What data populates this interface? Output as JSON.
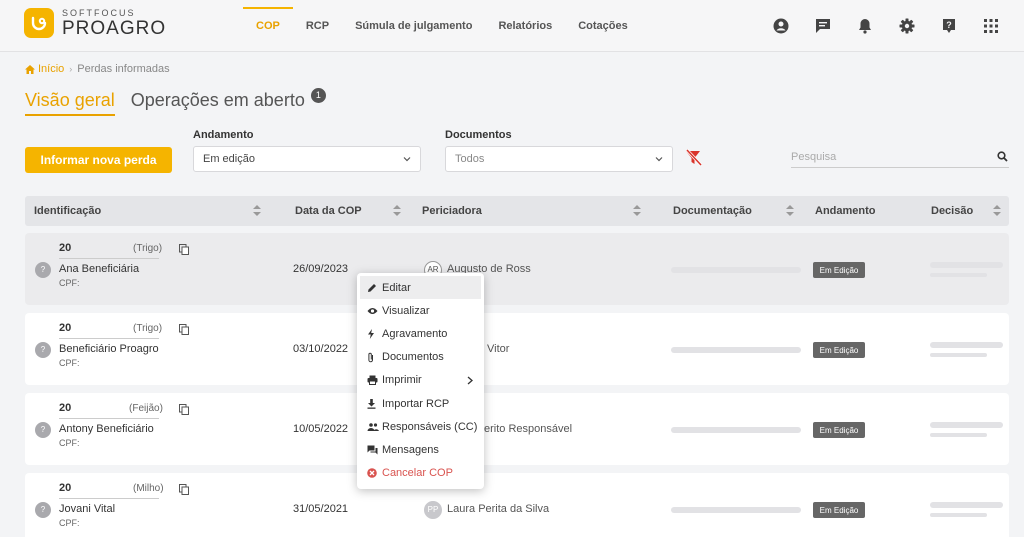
{
  "app": {
    "brand_small": "SOFTFOCUS",
    "brand_big": "PROAGRO",
    "accent": "#f5b400"
  },
  "nav": {
    "items": [
      {
        "label": "COP",
        "active": true
      },
      {
        "label": "RCP"
      },
      {
        "label": "Súmula de julgamento"
      },
      {
        "label": "Relatórios"
      },
      {
        "label": "Cotações"
      }
    ],
    "icons": [
      "account-circle-icon",
      "chat-icon",
      "bell-icon",
      "gear-icon",
      "help-icon",
      "apps-grid-icon"
    ]
  },
  "breadcrumb": {
    "home": "Início",
    "current": "Perdas informadas"
  },
  "tabs": {
    "overview": "Visão geral",
    "open_ops": "Operações em aberto",
    "open_ops_badge": "1"
  },
  "filters": {
    "new_loss_button": "Informar nova perda",
    "andamento_label": "Andamento",
    "andamento_value": "Em edição",
    "documentos_label": "Documentos",
    "documentos_value": "Todos",
    "search_placeholder": "Pesquisa"
  },
  "table": {
    "headers": {
      "identificacao": "Identificação",
      "data_cop": "Data da COP",
      "periciadora": "Periciadora",
      "documentacao": "Documentação",
      "andamento": "Andamento",
      "decisao": "Decisão"
    },
    "rows": [
      {
        "id": "20",
        "crop": "(Trigo)",
        "initial": "?",
        "name": "Ana Beneficiária",
        "cpf": "CPF:",
        "date": "26/09/2023",
        "perito_initials": "AR",
        "perito": "Augusto de Ross",
        "status": "Em Edição"
      },
      {
        "id": "20",
        "crop": "(Trigo)",
        "initial": "?",
        "name": "Beneficiário Proagro",
        "cpf": "CPF:",
        "date": "03/10/2022",
        "perito_initials": "",
        "perito": "Vitor",
        "status": "Em Edição"
      },
      {
        "id": "20",
        "crop": "(Feijão)",
        "initial": "?",
        "name": "Antony Beneficiário",
        "cpf": "CPF:",
        "date": "10/05/2022",
        "perito_initials": "",
        "perito": "erito Responsável",
        "status": "Em Edição"
      },
      {
        "id": "20",
        "crop": "(Milho)",
        "initial": "?",
        "name": "Jovani Vital",
        "cpf": "CPF:",
        "date": "31/05/2021",
        "perito_initials": "PP",
        "perito": "Laura Perita da Silva",
        "status": "Em Edição"
      }
    ]
  },
  "context_menu": {
    "items": [
      {
        "label": "Editar",
        "icon": "pencil-icon"
      },
      {
        "label": "Visualizar",
        "icon": "eye-icon"
      },
      {
        "label": "Agravamento",
        "icon": "bolt-icon"
      },
      {
        "label": "Documentos",
        "icon": "paperclip-icon"
      },
      {
        "label": "Imprimir",
        "icon": "printer-icon"
      },
      {
        "label": "Importar RCP",
        "icon": "download-icon"
      },
      {
        "label": "Responsáveis (CC)",
        "icon": "people-icon"
      },
      {
        "label": "Mensagens",
        "icon": "messages-icon"
      },
      {
        "label": "Cancelar COP",
        "icon": "cancel-circle-icon"
      }
    ]
  }
}
